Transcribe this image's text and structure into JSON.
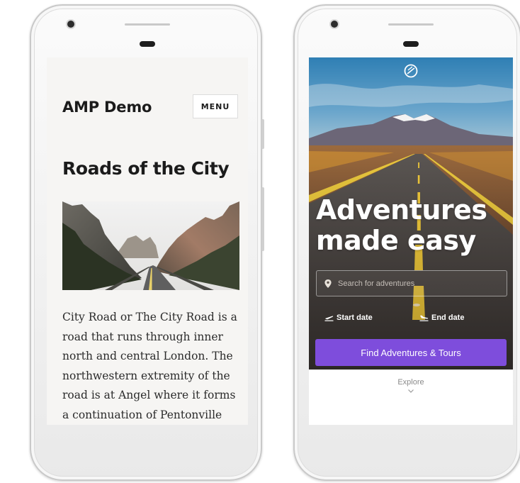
{
  "left_phone": {
    "site_title": "AMP Demo",
    "menu_label": "MENU",
    "post_title": "Roads of the City",
    "hero_icon": "road-landscape-image",
    "post_body": "City Road or The City Road is a road that runs through inner north and central London. The northwestern extremity of the road is at Angel where it forms a continuation of Pentonville"
  },
  "right_phone": {
    "logo_icon": "globe-logo-icon",
    "headline_line1": "Adventures",
    "headline_line2": "made easy",
    "search_placeholder": "Search for adventures",
    "search_icon": "location-pin-icon",
    "start_date_label": "Start date",
    "start_date_icon": "plane-takeoff-icon",
    "end_date_label": "End date",
    "end_date_icon": "plane-landing-icon",
    "cta_label": "Find Adventures & Tours",
    "explore_label": "Explore",
    "explore_icon": "chevron-down-icon"
  },
  "colors": {
    "accent": "#7e4ddc",
    "left_screen_bg": "#f6f5f3",
    "phone_body": "#f3f3f3",
    "heading_text": "#1b1b1b"
  }
}
